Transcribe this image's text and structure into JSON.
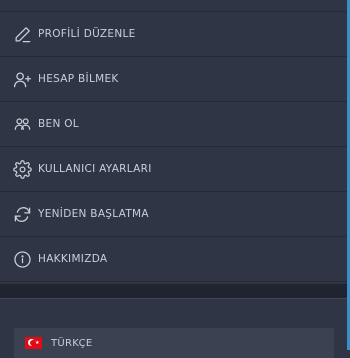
{
  "menu": {
    "items": [
      {
        "label": "PROFİLİ DÜZENLE",
        "icon": "edit-pen-icon"
      },
      {
        "label": "HESAP BİLMEK",
        "icon": "user-add-icon"
      },
      {
        "label": "BEN OL",
        "icon": "users-group-icon"
      },
      {
        "label": "KULLANICI AYARLARI",
        "icon": "gear-icon"
      },
      {
        "label": "YENİDEN BAŞLATMA",
        "icon": "refresh-icon"
      },
      {
        "label": "HAKKIMIZDA",
        "icon": "info-icon"
      }
    ]
  },
  "language": {
    "label": "TÜRKÇE",
    "flag_icon": "turkey-flag-icon"
  },
  "colors": {
    "background": "#2f3544",
    "accent": "#3a8fc8",
    "text": "#c9cfd9"
  }
}
